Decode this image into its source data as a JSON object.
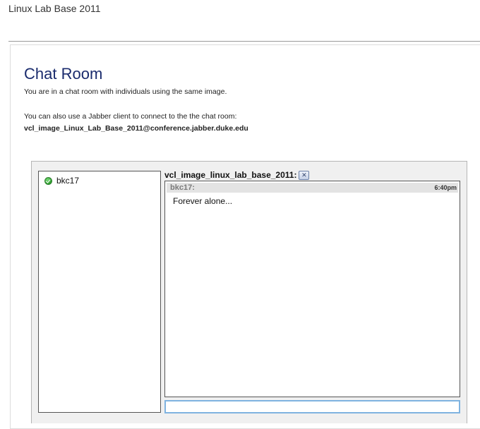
{
  "app": {
    "title": "Linux Lab Base 2011"
  },
  "page": {
    "title": "Chat Room",
    "intro": "You are in a chat room with individuals using the same image.",
    "jabber_text": "You can also use a Jabber client to connect to the the chat room:",
    "jabber_address": "vcl_image_Linux_Lab_Base_2011@conference.jabber.duke.edu"
  },
  "roster": {
    "users": [
      {
        "name": "bkc17",
        "status": "online",
        "status_icon": "online-check-icon",
        "status_color": "#2a9a2a"
      }
    ]
  },
  "room": {
    "name": "vcl_image_linux_lab_base_2011:",
    "close_icon": "close-icon"
  },
  "messages": [
    {
      "sender": "bkc17:",
      "time": "6:40pm",
      "text": "Forever alone..."
    }
  ],
  "input": {
    "value": "",
    "placeholder": ""
  },
  "colors": {
    "title": "#1a2b6d",
    "input_focus": "#7fb3e0"
  }
}
